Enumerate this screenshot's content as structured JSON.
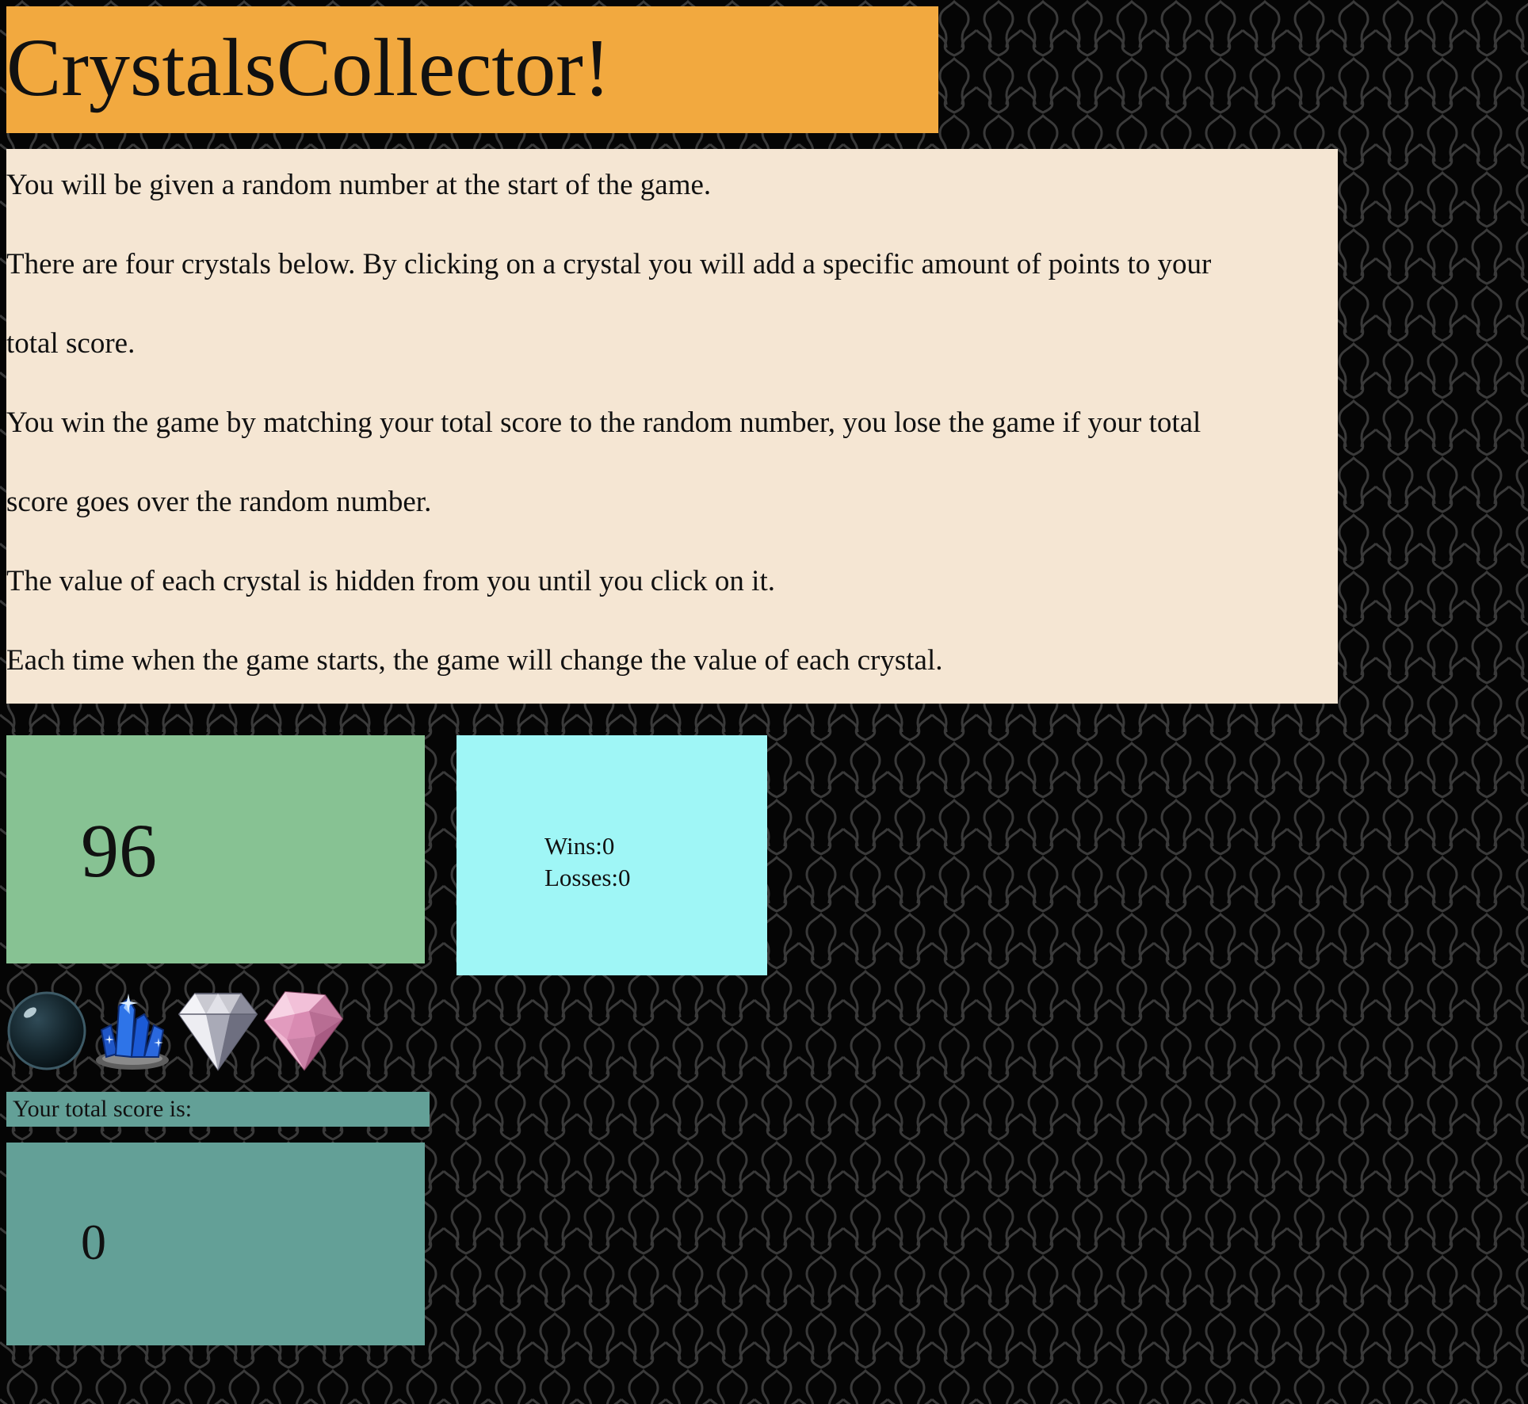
{
  "title": "CrystalsCollector!",
  "instructions": [
    "You will be given a random number at the start of the game.",
    "There are four crystals below. By clicking on a crystal you will add a specific amount of points to your",
    "total score.",
    "You win the game by matching your total score to the random number, you lose the game if your total",
    "score goes over the random number.",
    "The value of each crystal is hidden from you until you click on it.",
    "Each time when the game starts, the game will change the value of each crystal."
  ],
  "target": {
    "value": "96"
  },
  "record": {
    "wins_label": "Wins:",
    "wins": "0",
    "losses_label": "Losses:",
    "losses": "0"
  },
  "crystals": [
    {
      "icon": "dark-orb-crystal-icon"
    },
    {
      "icon": "blue-crystal-cluster-icon"
    },
    {
      "icon": "white-diamond-icon"
    },
    {
      "icon": "pink-gem-icon"
    }
  ],
  "score": {
    "label": "Your total score is:",
    "value": "0"
  },
  "colors": {
    "title_bg": "#f2a93f",
    "instructions_bg": "#f5e6d3",
    "target_bg": "#87c293",
    "record_bg": "#9ff6f6",
    "score_bg": "#63a097",
    "page_bg": "#050505"
  }
}
